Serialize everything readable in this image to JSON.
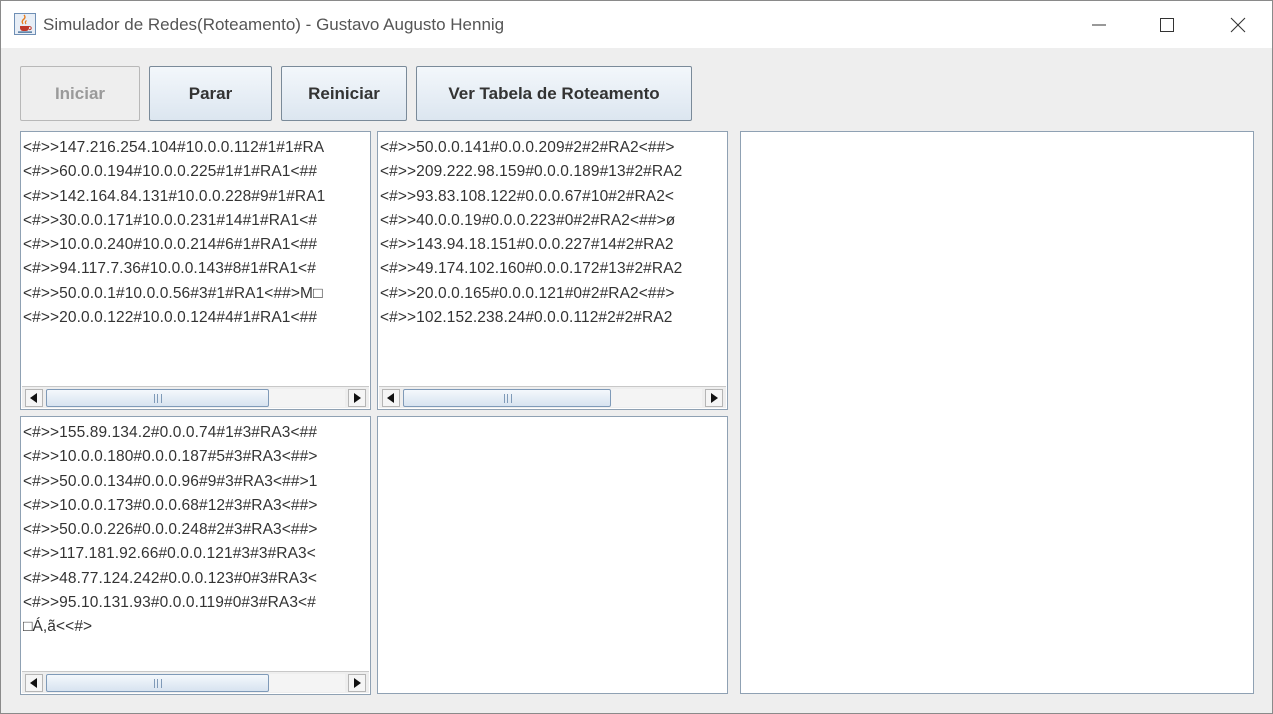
{
  "window": {
    "title": "Simulador de Redes(Roteamento) - Gustavo Augusto Hennig"
  },
  "toolbar": {
    "iniciar": "Iniciar",
    "parar": "Parar",
    "reiniciar": "Reiniciar",
    "ver_tabela": "Ver Tabela de Roteamento"
  },
  "panels": {
    "top_left": [
      "<#>>147.216.254.104#10.0.0.112#1#1#RA",
      "<#>>60.0.0.194#10.0.0.225#1#1#RA1<##",
      "<#>>142.164.84.131#10.0.0.228#9#1#RA1",
      "<#>>30.0.0.171#10.0.0.231#14#1#RA1<#",
      "<#>>10.0.0.240#10.0.0.214#6#1#RA1<##",
      "<#>>94.117.7.36#10.0.0.143#8#1#RA1<#",
      "<#>>50.0.0.1#10.0.0.56#3#1#RA1<##>M□",
      "<#>>20.0.0.122#10.0.0.124#4#1#RA1<##"
    ],
    "top_middle": [
      "<#>>50.0.0.141#0.0.0.209#2#2#RA2<##>",
      "<#>>209.222.98.159#0.0.0.189#13#2#RA2",
      "<#>>93.83.108.122#0.0.0.67#10#2#RA2<",
      "<#>>40.0.0.19#0.0.0.223#0#2#RA2<##>ø",
      "<#>>143.94.18.151#0.0.0.227#14#2#RA2",
      "<#>>49.174.102.160#0.0.0.172#13#2#RA2",
      "<#>>20.0.0.165#0.0.0.121#0#2#RA2<##>",
      "<#>>102.152.238.24#0.0.0.112#2#2#RA2"
    ],
    "bottom_left": [
      "<#>>155.89.134.2#0.0.0.74#1#3#RA3<##",
      "<#>>10.0.0.180#0.0.0.187#5#3#RA3<##>",
      "<#>>50.0.0.134#0.0.0.96#9#3#RA3<##>1",
      "<#>>10.0.0.173#0.0.0.68#12#3#RA3<##>",
      "<#>>50.0.0.226#0.0.0.248#2#3#RA3<##>",
      "<#>>117.181.92.66#0.0.0.121#3#3#RA3<",
      "<#>>48.77.124.242#0.0.0.123#0#3#RA3<",
      "<#>>95.10.131.93#0.0.0.119#0#3#RA3<#",
      "□Á,ã<<#>"
    ]
  },
  "colors": {
    "button_face": "#dce6f0",
    "scroll_thumb": "#d7e3f0",
    "window_bg": "#eeeeee"
  }
}
